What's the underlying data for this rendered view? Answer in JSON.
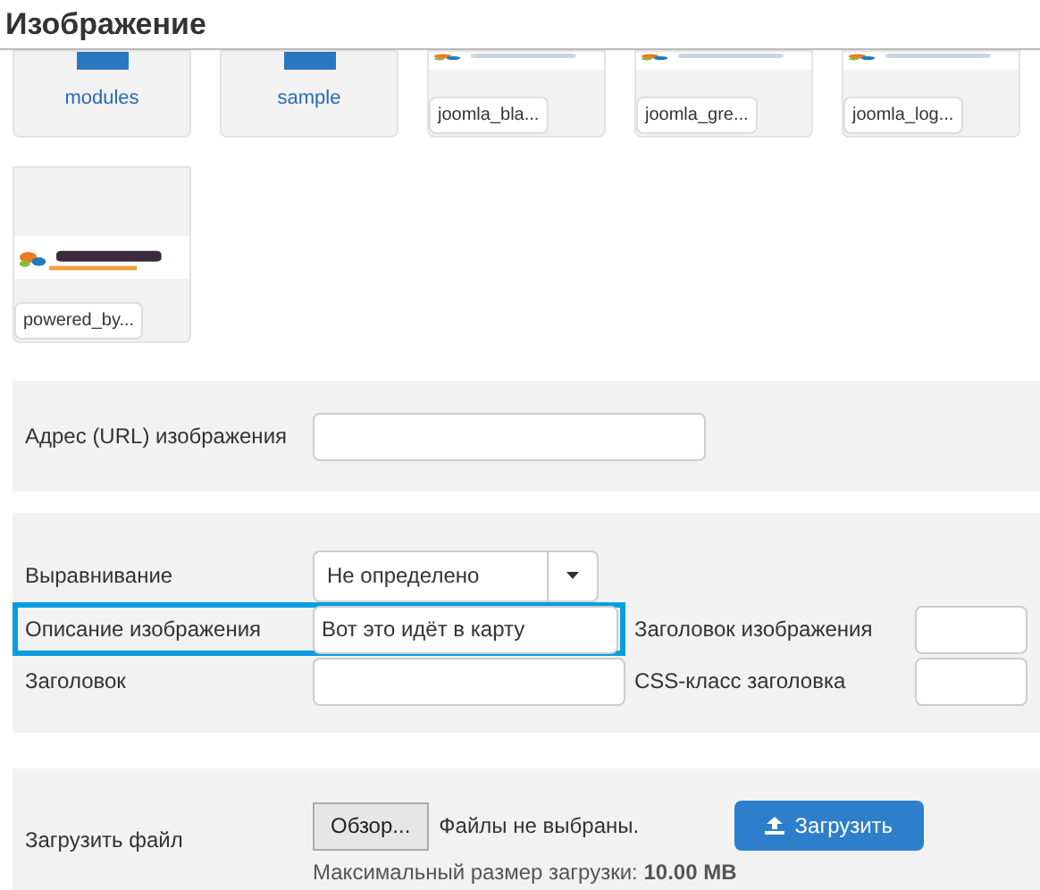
{
  "title": "Изображение",
  "thumbnails": [
    {
      "kind": "folder",
      "label": "modules"
    },
    {
      "kind": "folder",
      "label": "sample"
    },
    {
      "label": "joomla_bla..."
    },
    {
      "label": "joomla_gre..."
    },
    {
      "label": "joomla_log..."
    },
    {
      "label": "powered_by..."
    }
  ],
  "url_field": {
    "label": "Адрес (URL) изображения"
  },
  "alignment": {
    "label": "Выравнивание",
    "value": "Не определено"
  },
  "description": {
    "label": "Описание изображения",
    "value": "Вот это идёт в карту",
    "highlighted": true
  },
  "image_title": {
    "label": "Заголовок изображения"
  },
  "caption": {
    "label": "Заголовок"
  },
  "caption_class": {
    "label": "CSS-класс заголовка"
  },
  "upload": {
    "label": "Загрузить файл",
    "browse_button": "Обзор...",
    "file_status": "Файлы не выбраны.",
    "upload_button": "Загрузить",
    "max_size": "Максимальный размер загрузки: **10.00 MB**"
  }
}
